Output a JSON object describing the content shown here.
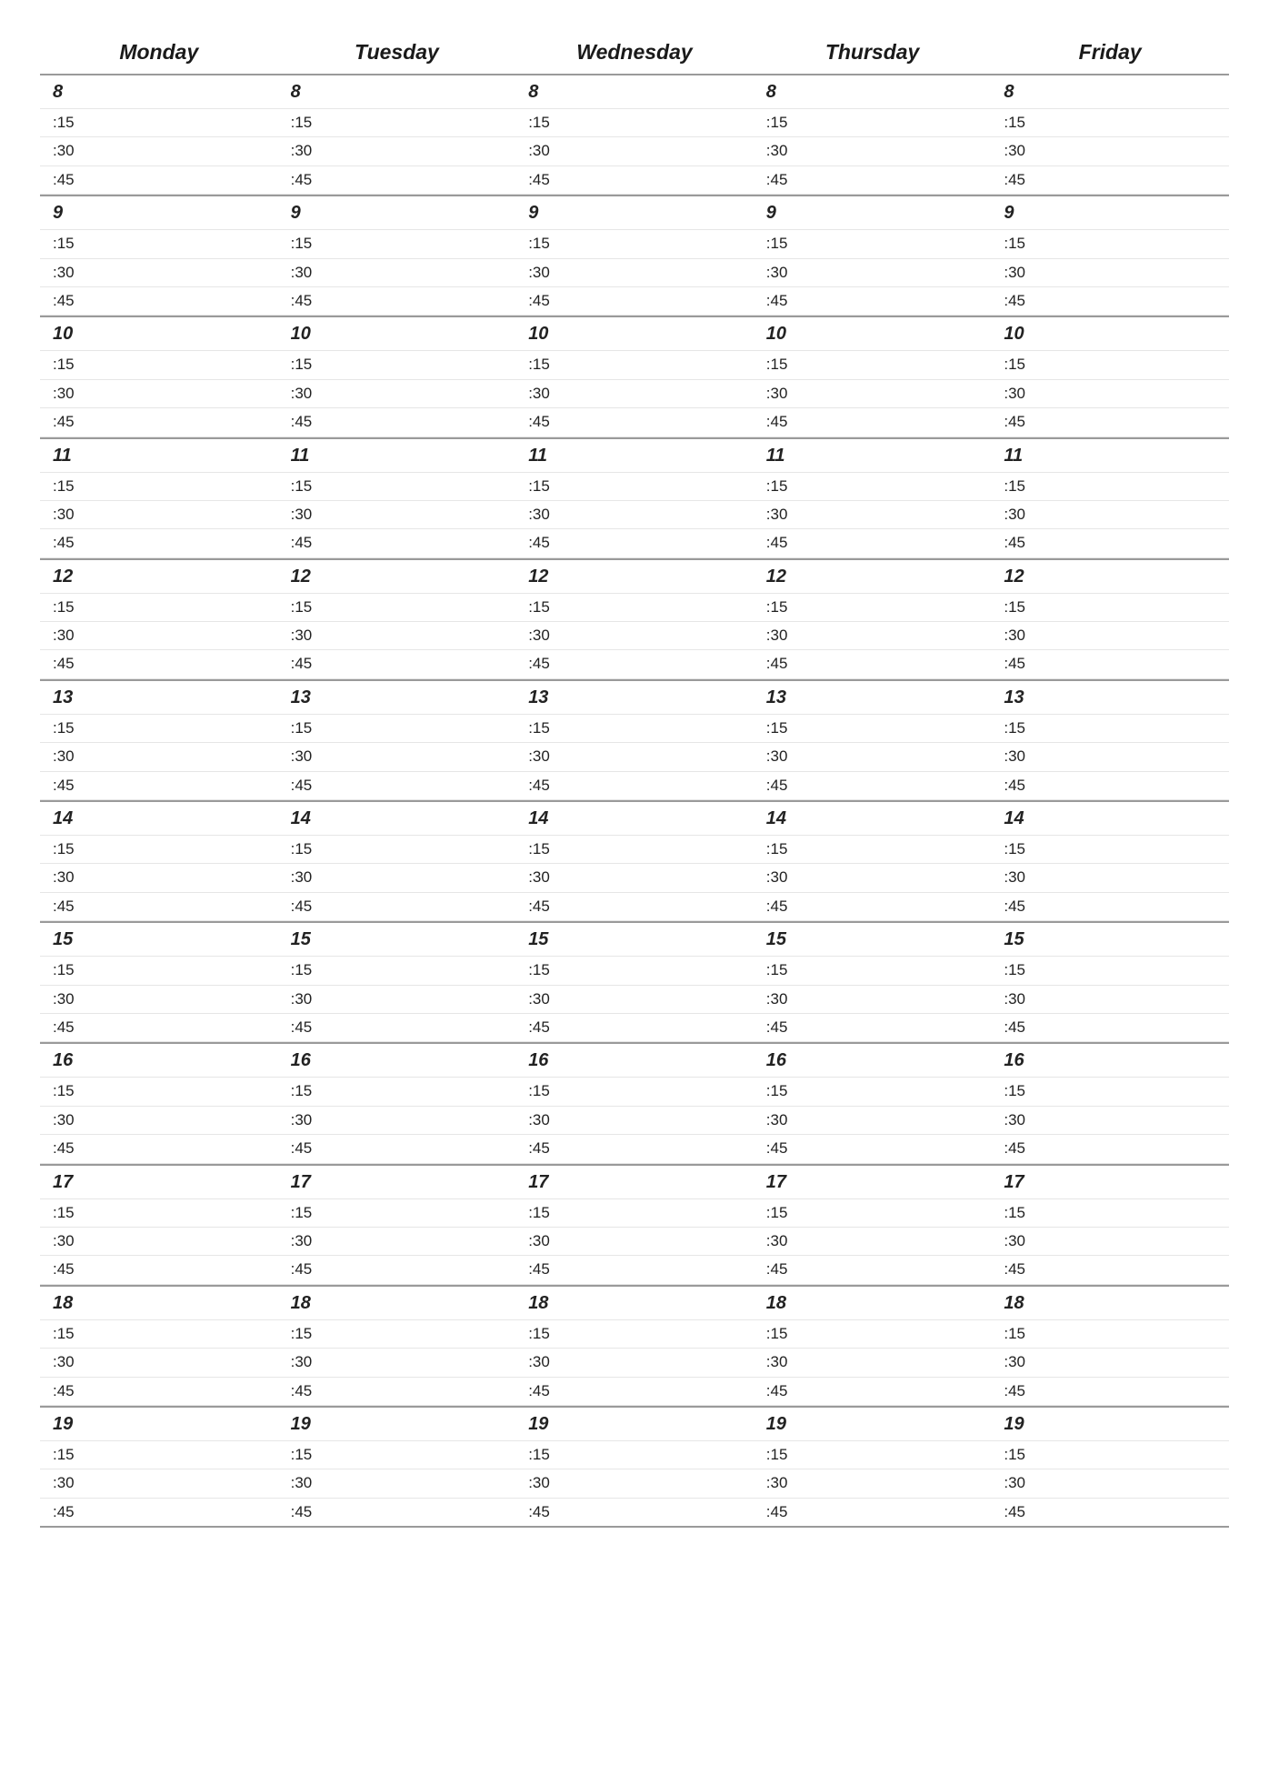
{
  "schedule": {
    "days": [
      "Monday",
      "Tuesday",
      "Wednesday",
      "Thursday",
      "Friday"
    ],
    "hours": [
      8,
      9,
      10,
      11,
      12,
      13,
      14,
      15,
      16,
      17,
      18,
      19
    ],
    "minute_marks": [
      ":15",
      ":30",
      ":45"
    ]
  }
}
